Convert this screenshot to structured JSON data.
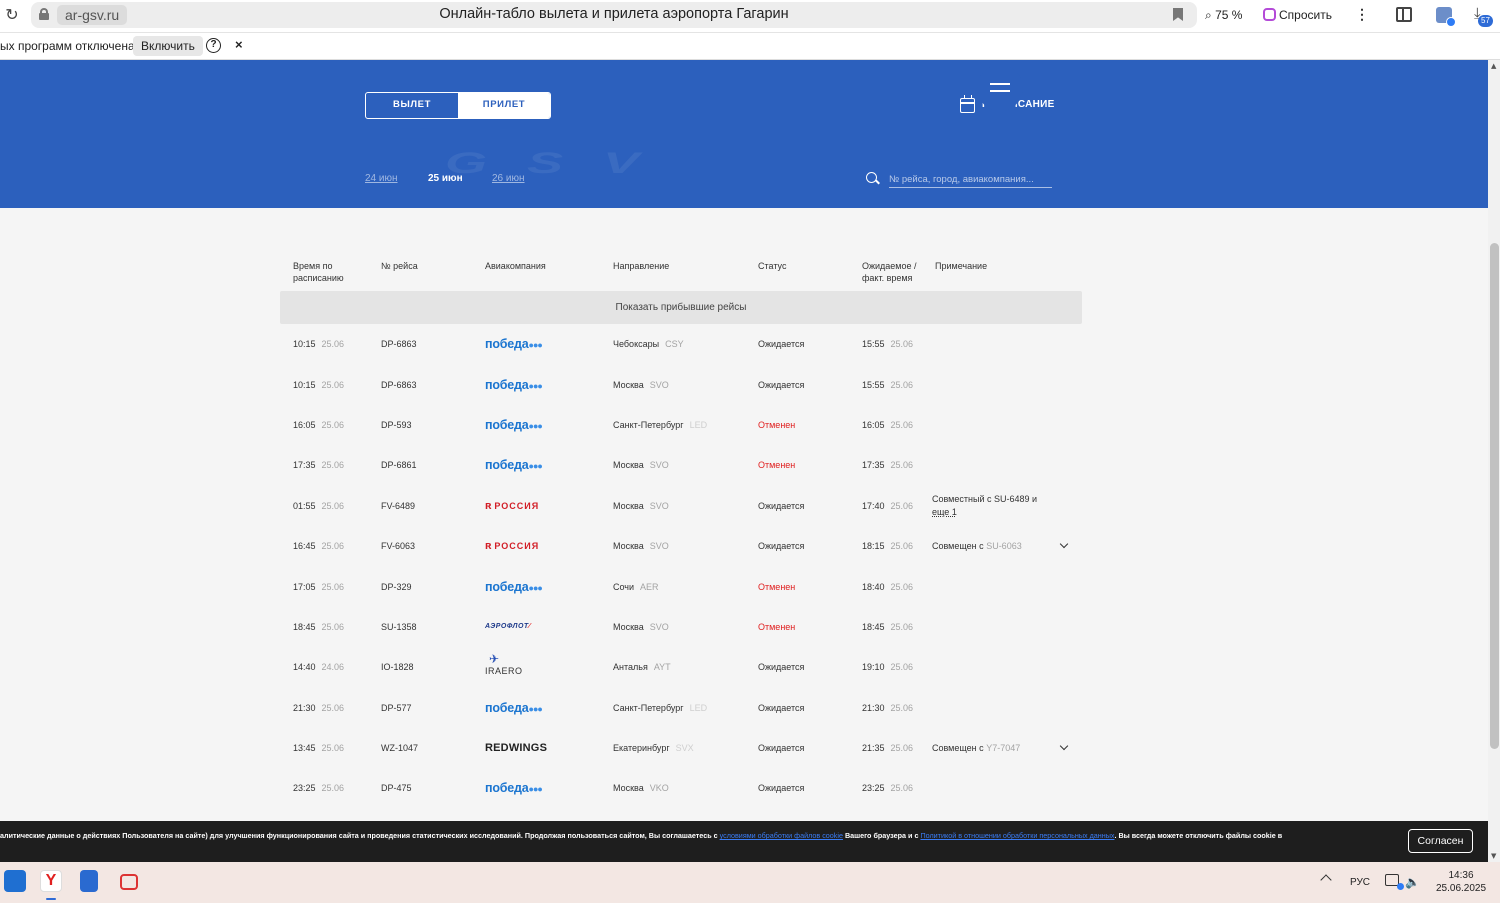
{
  "browser": {
    "domain": "ar-gsv.ru",
    "title": "Онлайн-табло вылета и прилета аэропорта Гагарин",
    "zoom": "75 %",
    "ask_label": "Спросить",
    "downloads_badge": "57",
    "notice_text": "ых программ отключена",
    "notice_enable": "Включить",
    "notice_help": "?",
    "notice_close": "×"
  },
  "header": {
    "tabs": {
      "departure": "ВЫЛЕТ",
      "arrival": "ПРИЛЕТ"
    },
    "schedule_label": "РАСПИСАНИЕ",
    "watermark": "GSV",
    "dates": [
      "24 июн",
      "25 июн",
      "26 июн"
    ],
    "active_date": "25 июн",
    "search_placeholder": "№ рейса, город, авиакомпания..."
  },
  "table": {
    "columns": {
      "scheduled": "Время по расписанию",
      "flight": "№ рейса",
      "airline": "Авиакомпания",
      "direction": "Направление",
      "status": "Статус",
      "expected": "Ожидаемое / факт. время",
      "note": "Примечание"
    },
    "show_arrived": "Показать прибывшие рейсы",
    "rows": [
      {
        "time": "10:15",
        "date": "25.06",
        "flight": "DP-6863",
        "airline": "pobeda",
        "city": "Чебоксары",
        "code": "CSY",
        "status": "Ожидается",
        "cancelled": false,
        "exp_time": "15:55",
        "exp_date": "25.06",
        "note": "",
        "note_extra": "",
        "expand": false
      },
      {
        "time": "10:15",
        "date": "25.06",
        "flight": "DP-6863",
        "airline": "pobeda",
        "city": "Москва",
        "code": "SVO",
        "status": "Ожидается",
        "cancelled": false,
        "exp_time": "15:55",
        "exp_date": "25.06",
        "note": "",
        "note_extra": "",
        "expand": false
      },
      {
        "time": "16:05",
        "date": "25.06",
        "flight": "DP-593",
        "airline": "pobeda",
        "city": "Санкт-Петербург",
        "code": "LED",
        "status": "Отменен",
        "cancelled": true,
        "exp_time": "16:05",
        "exp_date": "25.06",
        "note": "",
        "note_extra": "",
        "expand": false
      },
      {
        "time": "17:35",
        "date": "25.06",
        "flight": "DP-6861",
        "airline": "pobeda",
        "city": "Москва",
        "code": "SVO",
        "status": "Отменен",
        "cancelled": true,
        "exp_time": "17:35",
        "exp_date": "25.06",
        "note": "",
        "note_extra": "",
        "expand": false
      },
      {
        "time": "01:55",
        "date": "25.06",
        "flight": "FV-6489",
        "airline": "rossiya",
        "city": "Москва",
        "code": "SVO",
        "status": "Ожидается",
        "cancelled": false,
        "exp_time": "17:40",
        "exp_date": "25.06",
        "note": "Совместный с SU-6489 и",
        "note_extra": "еще 1",
        "expand": false
      },
      {
        "time": "16:45",
        "date": "25.06",
        "flight": "FV-6063",
        "airline": "rossiya",
        "city": "Москва",
        "code": "SVO",
        "status": "Ожидается",
        "cancelled": false,
        "exp_time": "18:15",
        "exp_date": "25.06",
        "note": "Совмещен с",
        "note_gray": "SU-6063",
        "note_extra": "",
        "expand": true
      },
      {
        "time": "17:05",
        "date": "25.06",
        "flight": "DP-329",
        "airline": "pobeda",
        "city": "Сочи",
        "code": "AER",
        "status": "Отменен",
        "cancelled": true,
        "exp_time": "18:40",
        "exp_date": "25.06",
        "note": "",
        "note_extra": "",
        "expand": false
      },
      {
        "time": "18:45",
        "date": "25.06",
        "flight": "SU-1358",
        "airline": "aeroflot",
        "city": "Москва",
        "code": "SVO",
        "status": "Отменен",
        "cancelled": true,
        "exp_time": "18:45",
        "exp_date": "25.06",
        "note": "",
        "note_extra": "",
        "expand": false
      },
      {
        "time": "14:40",
        "date": "24.06",
        "flight": "IO-1828",
        "airline": "iraero",
        "city": "Анталья",
        "code": "AYT",
        "status": "Ожидается",
        "cancelled": false,
        "exp_time": "19:10",
        "exp_date": "25.06",
        "note": "",
        "note_extra": "",
        "expand": false
      },
      {
        "time": "21:30",
        "date": "25.06",
        "flight": "DP-577",
        "airline": "pobeda",
        "city": "Санкт-Петербург",
        "code": "LED",
        "status": "Ожидается",
        "cancelled": false,
        "exp_time": "21:30",
        "exp_date": "25.06",
        "note": "",
        "note_extra": "",
        "expand": false
      },
      {
        "time": "13:45",
        "date": "25.06",
        "flight": "WZ-1047",
        "airline": "redwings",
        "city": "Екатеринбург",
        "code": "SVX",
        "status": "Ожидается",
        "cancelled": false,
        "exp_time": "21:35",
        "exp_date": "25.06",
        "note": "Совмещен с",
        "note_gray": "Y7-7047",
        "note_extra": "",
        "expand": true
      },
      {
        "time": "23:25",
        "date": "25.06",
        "flight": "DP-475",
        "airline": "pobeda",
        "city": "Москва",
        "code": "VKO",
        "status": "Ожидается",
        "cancelled": false,
        "exp_time": "23:25",
        "exp_date": "25.06",
        "note": "",
        "note_extra": "",
        "expand": false
      }
    ]
  },
  "logos": {
    "pobeda": "победа",
    "rossiya": "РОССИЯ",
    "aeroflot": "АЭРОФЛОТ",
    "iraero": "IRAERO",
    "redwings": "REDWINGS"
  },
  "cookie": {
    "text1": "алитические данные о действиях Пользователя на сайте) для улучшения функционирования сайта и проведения статистических исследований. Продолжая пользоваться сайтом, Вы соглашаетесь с ",
    "link1": "условиями обработки файлов cookie",
    "text2": " Вашего браузера и с ",
    "link2": "Политикой в отношении обработки персональных данных",
    "text3": ". Вы всегда можете отключить файлы cookie в",
    "accept": "Согласен"
  },
  "taskbar": {
    "lang": "РУС",
    "time": "14:36",
    "date": "25.06.2025"
  },
  "colors": {
    "header_bg": "#2c60bd",
    "cancelled": "#e02020",
    "pobeda": "#1b75d0",
    "rossiya": "#d21d26"
  }
}
